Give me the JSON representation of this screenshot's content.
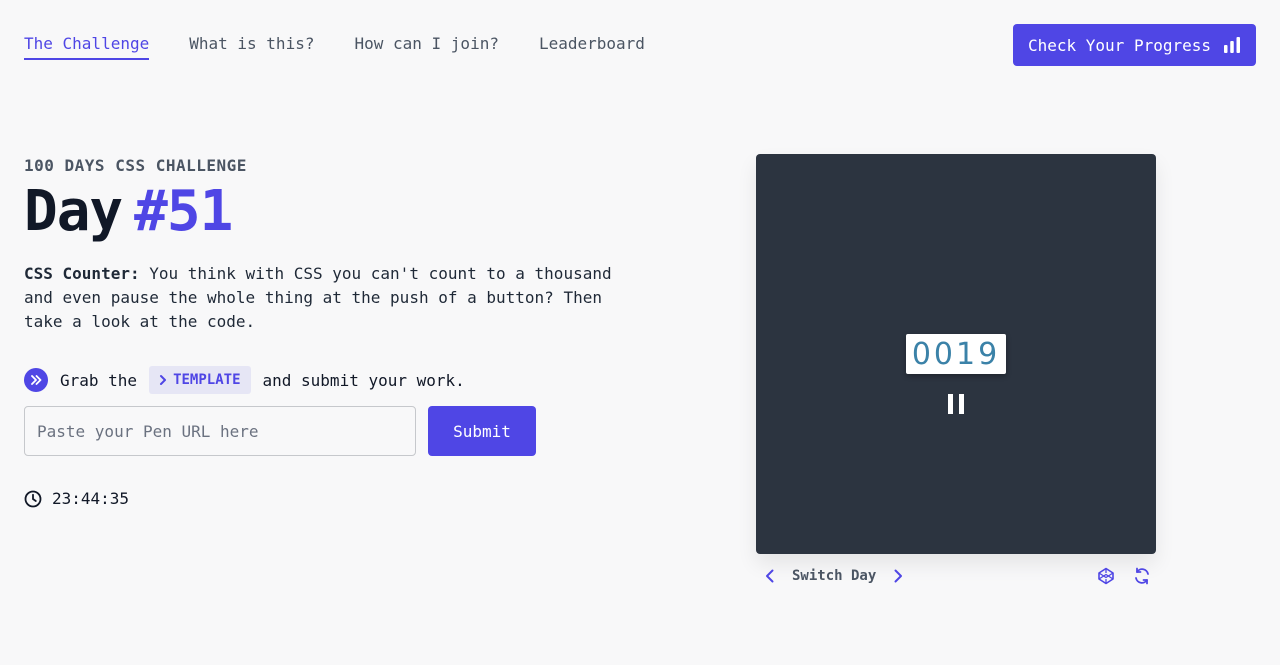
{
  "nav": {
    "links": [
      "The Challenge",
      "What is this?",
      "How can I join?",
      "Leaderboard"
    ],
    "progress_label": "Check Your Progress"
  },
  "challenge": {
    "eyebrow": "100 DAYS CSS CHALLENGE",
    "title_day": "Day",
    "title_number": "#51",
    "desc_bold": "CSS Counter:",
    "desc_text": " You think with CSS you can't count to a thousand and even pause the whole thing at the push of a button? Then take a look at the code."
  },
  "grab": {
    "prefix": "Grab the",
    "template_label": "TEMPLATE",
    "suffix": "and submit your work."
  },
  "form": {
    "placeholder": "Paste your Pen URL here",
    "submit_label": "Submit"
  },
  "timer": {
    "value": "23:44:35"
  },
  "preview": {
    "counter": "0019"
  },
  "footer": {
    "switch_label": "Switch Day"
  },
  "colors": {
    "accent": "#4f46e5",
    "preview_bg": "#2c3440",
    "counter_text": "#3b82a8"
  }
}
